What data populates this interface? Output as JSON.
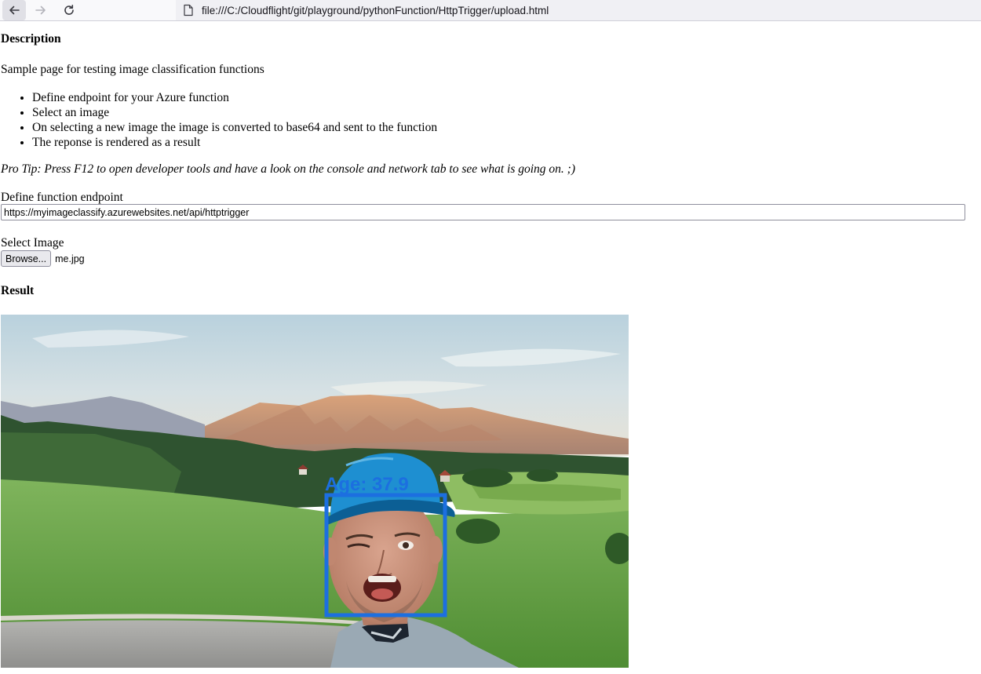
{
  "browser": {
    "url": "file:///C:/Cloudflight/git/playground/pythonFunction/HttpTrigger/upload.html"
  },
  "page": {
    "description_heading": "Description",
    "intro": "Sample page for testing image classification functions",
    "steps": [
      "Define endpoint for your Azure function",
      "Select an image",
      "On selecting a new image the image is converted to base64 and sent to the function",
      "The reponse is rendered as a result"
    ],
    "pro_tip": "Pro Tip: Press F12 to open developer tools and have a look on the console and network tab to see what is going on. ;)",
    "endpoint_label": "Define function endpoint",
    "endpoint_value": "https://myimageclassify.azurewebsites.net/api/httptrigger",
    "image_label": "Select Image",
    "browse_label": "Browse...",
    "file_name": "me.jpg",
    "result_heading": "Result",
    "result": {
      "age_label": "Age: 37.9",
      "annotation_color": "#1c6fe0"
    }
  }
}
